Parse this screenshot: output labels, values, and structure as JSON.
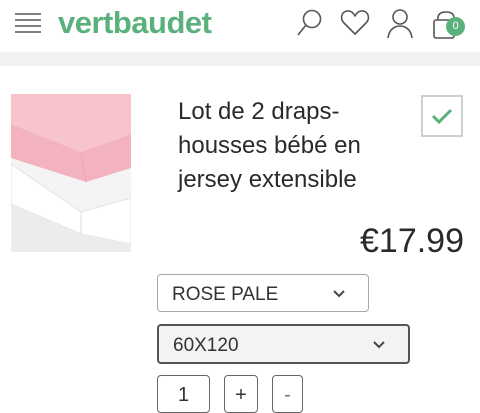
{
  "header": {
    "logo": "vertbaudet",
    "cart_count": "0",
    "icons": [
      "hamburger-menu-icon",
      "search-icon",
      "heart-icon",
      "user-icon",
      "cart-icon"
    ],
    "accent_color": "#5bb17b"
  },
  "product": {
    "title": "Lot de 2 draps-housses bébé en jersey extensible",
    "price": "€17.99",
    "image": "pink and white fitted sheets stacked"
  },
  "options": {
    "color": "ROSE PALE",
    "size": "60X120"
  },
  "quantity": {
    "value": "1",
    "plus": "+",
    "minus": "-"
  }
}
